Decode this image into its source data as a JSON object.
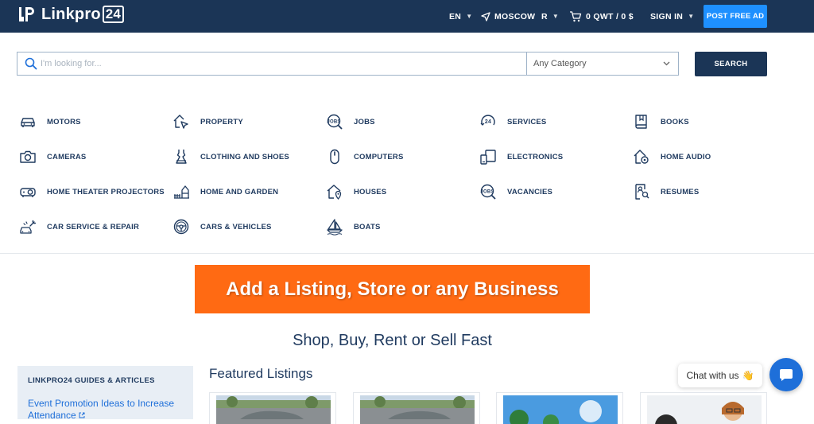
{
  "header": {
    "logo_text": "Linkpro",
    "logo_num": "24",
    "lang": "EN",
    "city": "MOSCOW",
    "currency": "R",
    "cart": "0 QWT / 0 $",
    "signin": "SIGN IN",
    "post_ad": "POST FREE AD"
  },
  "search": {
    "placeholder": "I'm looking for...",
    "category": "Any Category",
    "button": "SEARCH"
  },
  "categories": [
    {
      "label": "MOTORS",
      "icon": "car-icon"
    },
    {
      "label": "PROPERTY",
      "icon": "property-icon"
    },
    {
      "label": "JOBS",
      "icon": "jobs-icon"
    },
    {
      "label": "SERVICES",
      "icon": "services-24-icon"
    },
    {
      "label": "BOOKS",
      "icon": "book-icon"
    },
    {
      "label": "CAMERAS",
      "icon": "camera-icon"
    },
    {
      "label": "CLOTHING AND SHOES",
      "icon": "dress-icon"
    },
    {
      "label": "COMPUTERS",
      "icon": "mouse-icon"
    },
    {
      "label": "ELECTRONICS",
      "icon": "devices-icon"
    },
    {
      "label": "HOME AUDIO",
      "icon": "home-audio-icon"
    },
    {
      "label": "HOME THEATER PROJECTORS",
      "icon": "projector-icon"
    },
    {
      "label": "HOME AND GARDEN",
      "icon": "garden-icon"
    },
    {
      "label": "HOUSES",
      "icon": "house-icon"
    },
    {
      "label": "VACANCIES",
      "icon": "vacancies-icon"
    },
    {
      "label": "RESUMES",
      "icon": "resume-icon"
    },
    {
      "label": "CAR SERVICE & REPAIR",
      "icon": "car-repair-icon"
    },
    {
      "label": "CARS & VEHICLES",
      "icon": "steering-wheel-icon"
    },
    {
      "label": "BOATS",
      "icon": "boat-icon"
    }
  ],
  "banner": "Add a Listing, Store or any Business",
  "tagline": "Shop, Buy, Rent or Sell Fast",
  "sidebar": {
    "title": "LINKPRO24 GUIDES & ARTICLES",
    "link": "Event Promotion Ideas to Increase Attendance"
  },
  "featured_title": "Featured Listings",
  "chat": {
    "label": "Chat with us",
    "emoji": "👋"
  },
  "colors": {
    "navy": "#1b3556",
    "accent_blue": "#1e90ff",
    "banner_orange": "#ff6a13"
  }
}
